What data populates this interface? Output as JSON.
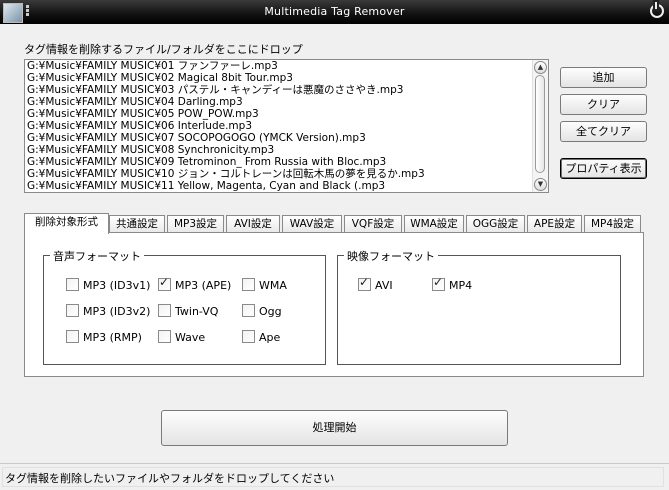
{
  "window": {
    "title": "Multimedia Tag Remover"
  },
  "drop_label": "タグ情報を削除するファイル/フォルダをここにドロップ",
  "files": [
    "G:¥Music¥FAMILY MUSIC¥01 ファンファーレ.mp3",
    "G:¥Music¥FAMILY MUSIC¥02 Magical 8bit Tour.mp3",
    "G:¥Music¥FAMILY MUSIC¥03 パステル・キャンディーは悪魔のささやき.mp3",
    "G:¥Music¥FAMILY MUSIC¥04 Darling.mp3",
    "G:¥Music¥FAMILY MUSIC¥05 POW_POW.mp3",
    "G:¥Music¥FAMILY MUSIC¥06 Interlude.mp3",
    "G:¥Music¥FAMILY MUSIC¥07 SOCOPOGOGO (YMCK Version).mp3",
    "G:¥Music¥FAMILY MUSIC¥08 Synchronicity.mp3",
    "G:¥Music¥FAMILY MUSIC¥09 Tetrominon_ From Russia with Bloc.mp3",
    "G:¥Music¥FAMILY MUSIC¥10 ジョン・コルトレーンは回転木馬の夢を見るか.mp3",
    "G:¥Music¥FAMILY MUSIC¥11 Yellow, Magenta, Cyan and Black (.mp3"
  ],
  "buttons": {
    "add": "追加",
    "clear": "クリア",
    "clear_all": "全てクリア",
    "properties": "プロパティ表示",
    "start": "処理開始"
  },
  "tabs": [
    {
      "label": "削除対象形式",
      "active": true
    },
    {
      "label": "共通設定"
    },
    {
      "label": "MP3設定"
    },
    {
      "label": "AVI設定"
    },
    {
      "label": "WAV設定"
    },
    {
      "label": "VQF設定"
    },
    {
      "label": "WMA設定"
    },
    {
      "label": "OGG設定"
    },
    {
      "label": "APE設定"
    },
    {
      "label": "MP4設定"
    }
  ],
  "audio_group": {
    "title": "音声フォーマット",
    "items": [
      {
        "label": "MP3 (ID3v1)",
        "checked": false
      },
      {
        "label": "MP3 (APE)",
        "checked": true
      },
      {
        "label": "WMA",
        "checked": false
      },
      {
        "label": "MP3 (ID3v2)",
        "checked": false
      },
      {
        "label": "Twin-VQ",
        "checked": false
      },
      {
        "label": "Ogg",
        "checked": false
      },
      {
        "label": "MP3 (RMP)",
        "checked": false
      },
      {
        "label": "Wave",
        "checked": false
      },
      {
        "label": "Ape",
        "checked": false
      }
    ]
  },
  "video_group": {
    "title": "映像フォーマット",
    "items": [
      {
        "label": "AVI",
        "checked": true
      },
      {
        "label": "MP4",
        "checked": true
      }
    ]
  },
  "status": "タグ情報を削除したいファイルやフォルダをドロップしてください"
}
